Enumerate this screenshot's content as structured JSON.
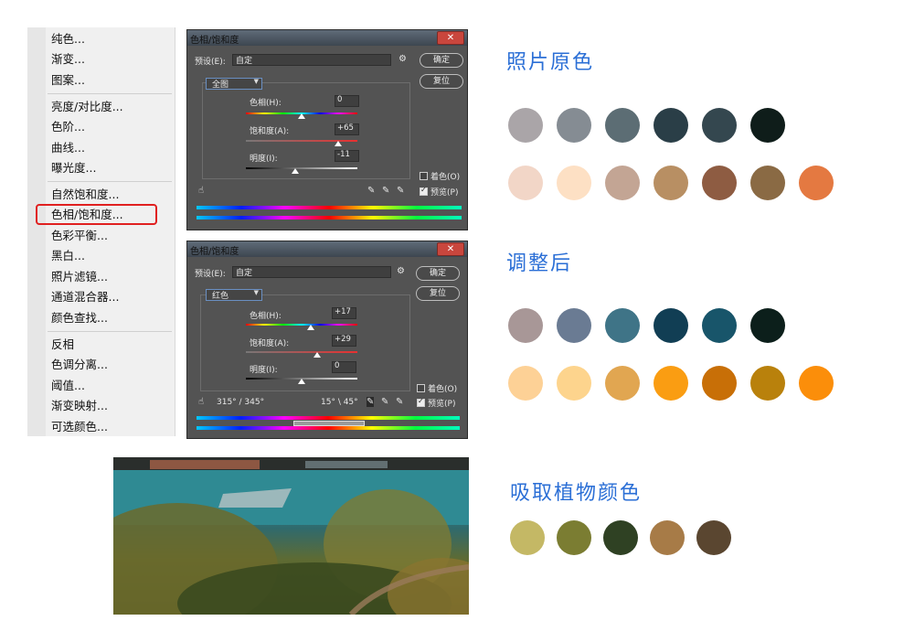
{
  "menu": {
    "group1": [
      "纯色...",
      "渐变...",
      "图案..."
    ],
    "group2": [
      "亮度/对比度...",
      "色阶...",
      "曲线...",
      "曝光度..."
    ],
    "group3": [
      "自然饱和度...",
      "色相/饱和度...",
      "色彩平衡...",
      "黑白...",
      "照片滤镜...",
      "通道混合器...",
      "颜色查找..."
    ],
    "group4": [
      "反相",
      "色调分离...",
      "阈值...",
      "渐变映射...",
      "可选颜色..."
    ],
    "highlighted_item": "色相/饱和度..."
  },
  "dialog1": {
    "title": "色相/饱和度",
    "preset_label": "预设(E):",
    "preset_value": "自定",
    "ok_label": "确定",
    "reset_label": "复位",
    "channel": "全图",
    "hue_label": "色相(H):",
    "hue_value": "0",
    "sat_label": "饱和度(A):",
    "sat_value": "+65",
    "light_label": "明度(I):",
    "light_value": "-11",
    "colorize_label": "着色(O)",
    "preview_label": "预览(P)",
    "colorize_checked": false,
    "preview_checked": true
  },
  "dialog2": {
    "title": "色相/饱和度",
    "preset_label": "预设(E):",
    "preset_value": "自定",
    "ok_label": "确定",
    "reset_label": "复位",
    "channel": "红色",
    "hue_label": "色相(H):",
    "hue_value": "+17",
    "sat_label": "饱和度(A):",
    "sat_value": "+29",
    "light_label": "明度(I):",
    "light_value": "0",
    "colorize_label": "着色(O)",
    "preview_label": "预览(P)",
    "range_left": "315° / 345°",
    "range_right": "15° \\ 45°",
    "colorize_checked": false,
    "preview_checked": true
  },
  "palettes": {
    "original": {
      "title": "照片原色",
      "row1": [
        "#aaa5a8",
        "#858c93",
        "#5c6d74",
        "#2a3e47",
        "#34474f",
        "#0f1d1a"
      ],
      "row2": [
        "#f2d6c7",
        "#fde0c4",
        "#c3a594",
        "#b88f63",
        "#8e5c42",
        "#8a6a44",
        "#e47941"
      ]
    },
    "adjusted": {
      "title": "调整后",
      "row1": [
        "#a89797",
        "#6a7b93",
        "#3f7487",
        "#113e54",
        "#18556a",
        "#0c1f1b"
      ],
      "row2": [
        "#fdd196",
        "#fdd48d",
        "#e1a651",
        "#fa9d12",
        "#c86f07",
        "#b9810c",
        "#fb8e0a"
      ]
    },
    "plants": {
      "title": "吸取植物颜色",
      "row1": [
        "#c4b865",
        "#7b7d32",
        "#2f4123",
        "#a77b47",
        "#5a4630"
      ]
    }
  }
}
